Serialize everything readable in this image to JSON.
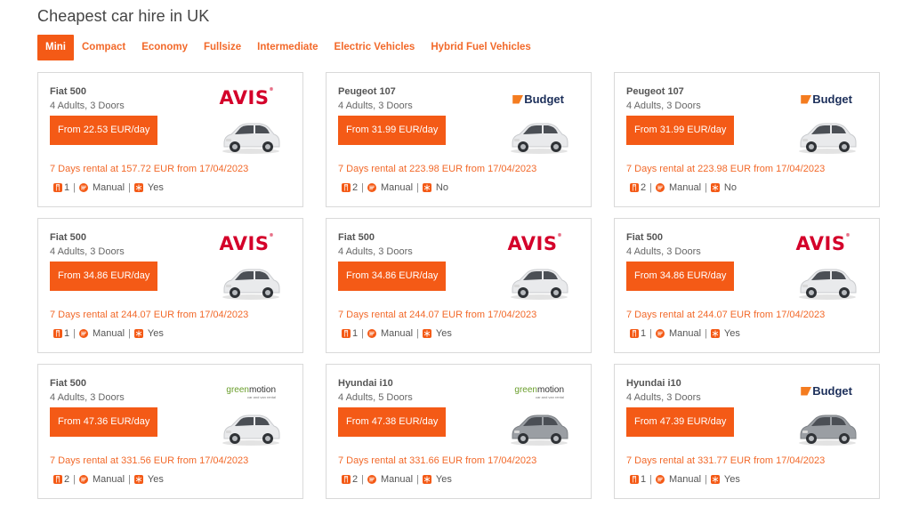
{
  "page": {
    "title": "Cheapest car hire in UK"
  },
  "tabs": [
    {
      "label": "Mini",
      "active": true
    },
    {
      "label": "Compact",
      "active": false
    },
    {
      "label": "Economy",
      "active": false
    },
    {
      "label": "Fullsize",
      "active": false
    },
    {
      "label": "Intermediate",
      "active": false
    },
    {
      "label": "Electric Vehicles",
      "active": false
    },
    {
      "label": "Hybrid Fuel Vehicles",
      "active": false
    }
  ],
  "colors": {
    "accent": "#f45a16",
    "accent_text": "#f2692a",
    "avis": "#d4002a",
    "budget": "#1c2f5a"
  },
  "cards": [
    {
      "car": "Fiat 500",
      "details": "4 Adults, 3 Doors",
      "price": "From 22.53 EUR/day",
      "rental": "7 Days rental at 157.72 EUR from 17/04/2023",
      "bags": "1",
      "transmission": "Manual",
      "ac": "Yes",
      "supplier": "avis",
      "car_color": "white"
    },
    {
      "car": "Peugeot 107",
      "details": "4 Adults, 3 Doors",
      "price": "From 31.99 EUR/day",
      "rental": "7 Days rental at 223.98 EUR from 17/04/2023",
      "bags": "2",
      "transmission": "Manual",
      "ac": "No",
      "supplier": "budget",
      "car_color": "white"
    },
    {
      "car": "Peugeot 107",
      "details": "4 Adults, 3 Doors",
      "price": "From 31.99 EUR/day",
      "rental": "7 Days rental at 223.98 EUR from 17/04/2023",
      "bags": "2",
      "transmission": "Manual",
      "ac": "No",
      "supplier": "budget",
      "car_color": "white"
    },
    {
      "car": "Fiat 500",
      "details": "4 Adults, 3 Doors",
      "price": "From 34.86 EUR/day",
      "rental": "7 Days rental at 244.07 EUR from 17/04/2023",
      "bags": "1",
      "transmission": "Manual",
      "ac": "Yes",
      "supplier": "avis",
      "car_color": "white"
    },
    {
      "car": "Fiat 500",
      "details": "4 Adults, 3 Doors",
      "price": "From 34.86 EUR/day",
      "rental": "7 Days rental at 244.07 EUR from 17/04/2023",
      "bags": "1",
      "transmission": "Manual",
      "ac": "Yes",
      "supplier": "avis",
      "car_color": "white"
    },
    {
      "car": "Fiat 500",
      "details": "4 Adults, 3 Doors",
      "price": "From 34.86 EUR/day",
      "rental": "7 Days rental at 244.07 EUR from 17/04/2023",
      "bags": "1",
      "transmission": "Manual",
      "ac": "Yes",
      "supplier": "avis",
      "car_color": "white"
    },
    {
      "car": "Fiat 500",
      "details": "4 Adults, 3 Doors",
      "price": "From 47.36 EUR/day",
      "rental": "7 Days rental at 331.56 EUR from 17/04/2023",
      "bags": "2",
      "transmission": "Manual",
      "ac": "Yes",
      "supplier": "greenmotion",
      "car_color": "white"
    },
    {
      "car": "Hyundai i10",
      "details": "4 Adults, 5 Doors",
      "price": "From 47.38 EUR/day",
      "rental": "7 Days rental at 331.66 EUR from 17/04/2023",
      "bags": "2",
      "transmission": "Manual",
      "ac": "Yes",
      "supplier": "greenmotion",
      "car_color": "gray"
    },
    {
      "car": "Hyundai i10",
      "details": "4 Adults, 3 Doors",
      "price": "From 47.39 EUR/day",
      "rental": "7 Days rental at 331.77 EUR from 17/04/2023",
      "bags": "1",
      "transmission": "Manual",
      "ac": "Yes",
      "supplier": "budget",
      "car_color": "gray"
    }
  ],
  "logos": {
    "avis": "AVIS",
    "budget": "Budget",
    "greenmotion_a": "green",
    "greenmotion_b": "motion",
    "greenmotion_tag": "car and van rental"
  }
}
